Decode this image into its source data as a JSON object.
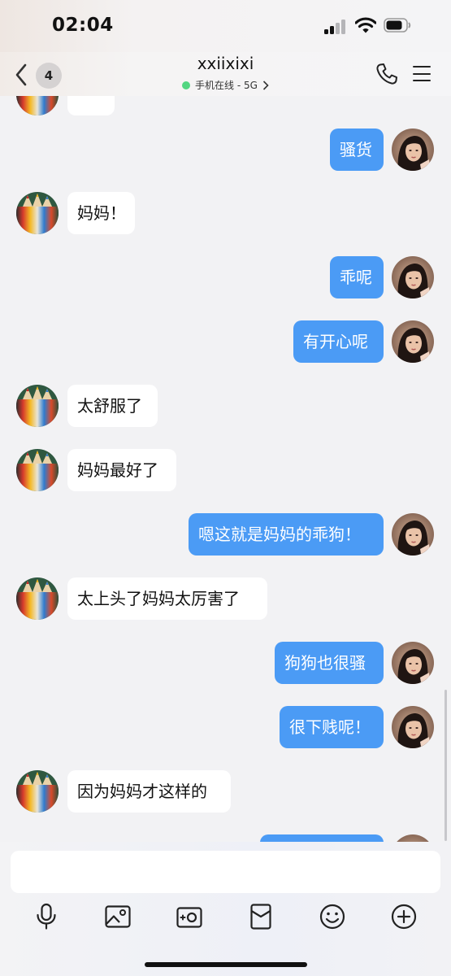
{
  "status_bar": {
    "time": "02:04"
  },
  "header": {
    "back_badge": "4",
    "title": "xxiixixi",
    "subtitle": "手机在线 - 5G"
  },
  "messages": [
    {
      "side": "right",
      "text": "骚货"
    },
    {
      "side": "left",
      "text": "妈妈！"
    },
    {
      "side": "right",
      "text": "乖呢"
    },
    {
      "side": "right",
      "text": "有开心呢"
    },
    {
      "side": "left",
      "text": "太舒服了"
    },
    {
      "side": "left",
      "text": "妈妈最好了"
    },
    {
      "side": "right",
      "text": "嗯这就是妈妈的乖狗！"
    },
    {
      "side": "left",
      "text": "太上头了妈妈太厉害了"
    },
    {
      "side": "right",
      "text": "狗狗也很骚"
    },
    {
      "side": "right",
      "text": "很下贱呢！"
    },
    {
      "side": "left",
      "text": "因为妈妈才这样的"
    },
    {
      "side": "right",
      "text": ""
    }
  ],
  "input": {
    "value": ""
  },
  "toolbar": {
    "icons": [
      "microphone-icon",
      "image-icon",
      "camera-icon",
      "red-packet-icon",
      "emoji-icon",
      "plus-icon"
    ]
  },
  "colors": {
    "accent": "#4b9bf5",
    "background": "#f2f2f4",
    "incoming_bubble": "#ffffff",
    "online_dot": "#52d681"
  }
}
